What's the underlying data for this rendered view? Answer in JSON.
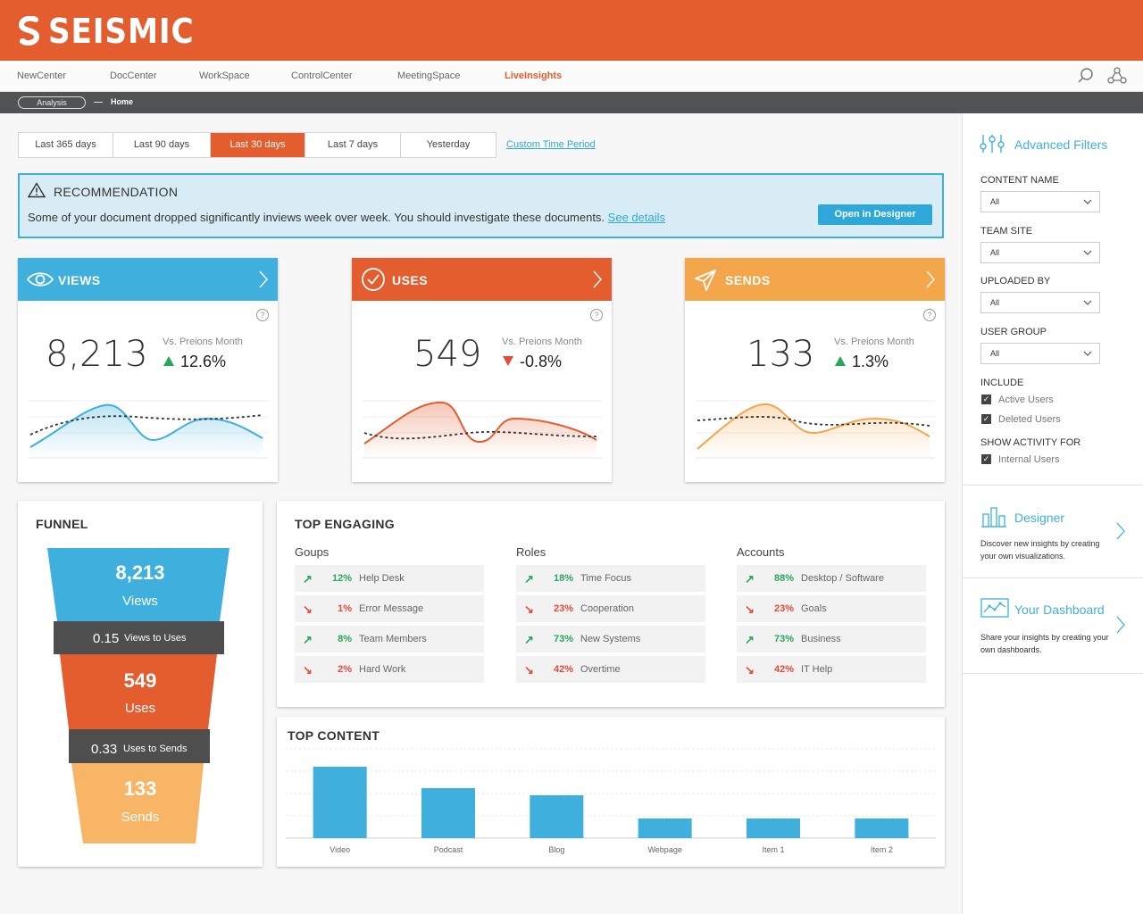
{
  "brand": {
    "name": "SEISMIC",
    "color": "#e35d2f"
  },
  "nav": {
    "items": [
      {
        "label": "NewCenter",
        "active": false
      },
      {
        "label": "DocCenter",
        "active": false
      },
      {
        "label": "WorkSpace",
        "active": false
      },
      {
        "label": "ControlCenter",
        "active": false
      },
      {
        "label": "MeetingSpace",
        "active": false
      },
      {
        "label": "LiveInsights",
        "active": true
      }
    ],
    "icons": [
      "search-icon",
      "network-icon"
    ]
  },
  "breadcrumb": {
    "pill": "Analysis",
    "current": "Home"
  },
  "time_tabs": {
    "items": [
      "Last 365 days",
      "Last 90 days",
      "Last 30 days",
      "Last 7 days",
      "Yesterday"
    ],
    "selected": "Last 30 days",
    "custom_link": "Custom Time Period"
  },
  "recommendation": {
    "title": "RECOMMENDATION",
    "text": "Some of your document dropped significantly inviews week over week. You should investigate these documents.",
    "link": "See details",
    "button": "Open in Designer"
  },
  "kpis": [
    {
      "label": "VIEWS",
      "value": "8,213",
      "vs_label": "Vs. Preions Month",
      "change": "12.6%",
      "direction": "up",
      "color": "#3fb0dd",
      "icon": "eye-icon"
    },
    {
      "label": "USES",
      "value": "549",
      "vs_label": "Vs. Preions Month",
      "change": "-0.8%",
      "direction": "down",
      "color": "#e35d2f",
      "icon": "check-circle-icon"
    },
    {
      "label": "SENDS",
      "value": "133",
      "vs_label": "Vs. Preions Month",
      "change": "1.3%",
      "direction": "up",
      "color": "#f4a64a",
      "icon": "send-icon"
    }
  ],
  "funnel": {
    "title": "FUNNEL",
    "stages": [
      {
        "value": "8,213",
        "label": "Views",
        "color": "#3fb0dd"
      },
      {
        "value": "549",
        "label": "Uses",
        "color": "#e35d2f"
      },
      {
        "value": "133",
        "label": "Sends",
        "color": "#f9b566"
      }
    ],
    "ratios": [
      {
        "value": "0.15",
        "label": "Views to Uses"
      },
      {
        "value": "0.33",
        "label": "Uses to Sends"
      }
    ]
  },
  "top_engaging": {
    "title": "TOP ENGAGING",
    "columns": [
      {
        "title": "Goups",
        "rows": [
          {
            "pct": "12%",
            "name": "Help Desk",
            "dir": "up"
          },
          {
            "pct": "1%",
            "name": "Error Message",
            "dir": "down"
          },
          {
            "pct": "8%",
            "name": "Team Members",
            "dir": "up"
          },
          {
            "pct": "2%",
            "name": "Hard Work",
            "dir": "down"
          }
        ]
      },
      {
        "title": "Roles",
        "rows": [
          {
            "pct": "18%",
            "name": "Time Focus",
            "dir": "up"
          },
          {
            "pct": "23%",
            "name": "Cooperation",
            "dir": "down"
          },
          {
            "pct": "73%",
            "name": "New Systems",
            "dir": "up"
          },
          {
            "pct": "42%",
            "name": "Overtime",
            "dir": "down"
          }
        ]
      },
      {
        "title": "Accounts",
        "rows": [
          {
            "pct": "88%",
            "name": "Desktop / Software",
            "dir": "up"
          },
          {
            "pct": "23%",
            "name": "Goals",
            "dir": "down"
          },
          {
            "pct": "73%",
            "name": "Business",
            "dir": "up"
          },
          {
            "pct": "42%",
            "name": "IT Help",
            "dir": "down"
          }
        ]
      }
    ]
  },
  "chart_data": {
    "type": "bar",
    "title": "TOP CONTENT",
    "categories": [
      "Video",
      "Podcast",
      "Blog",
      "Webpage",
      "Item 1",
      "Item 2"
    ],
    "values": [
      80,
      56,
      48,
      22,
      22,
      22
    ],
    "ylim": [
      0,
      100
    ],
    "grid": true,
    "color": "#3fb0dd"
  },
  "sidebar": {
    "filters_title": "Advanced Filters",
    "filters": [
      {
        "label": "CONTENT NAME",
        "value": "All"
      },
      {
        "label": "TEAM SITE",
        "value": "All"
      },
      {
        "label": "UPLOADED BY",
        "value": "All"
      },
      {
        "label": "USER GROUP",
        "value": "All"
      }
    ],
    "include_label": "INCLUDE",
    "include": [
      {
        "label": "Active Users",
        "checked": true
      },
      {
        "label": "Deleted Users",
        "checked": true
      }
    ],
    "show_label": "SHOW ACTIVITY FOR",
    "show": [
      {
        "label": "Internal Users",
        "checked": true
      }
    ],
    "promos": [
      {
        "title": "Designer",
        "text": "Discover new insights by creating your own visualizations."
      },
      {
        "title": "Your Dashboard",
        "text": "Share your insights by creating your own dashboards."
      }
    ]
  }
}
